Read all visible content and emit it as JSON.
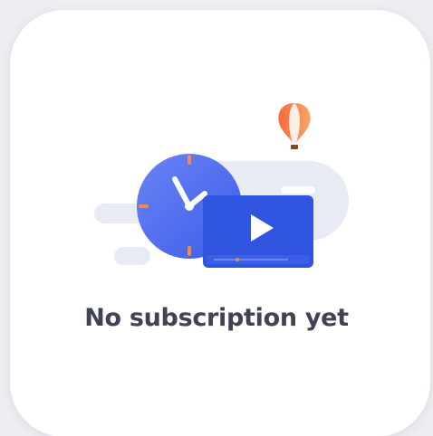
{
  "empty_state": {
    "title": "No subscription yet",
    "illustration": {
      "icons": [
        "clock-icon",
        "video-play-icon",
        "hot-air-balloon-icon"
      ]
    }
  },
  "colors": {
    "card_background": "#ffffff",
    "page_background": "#eceef2",
    "title_text": "#3f4354",
    "clock_blue": "#4f6ef0",
    "video_blue": "#3558e2",
    "balloon_orange": "#f4894f",
    "decor_gray": "#e7eaf3"
  }
}
